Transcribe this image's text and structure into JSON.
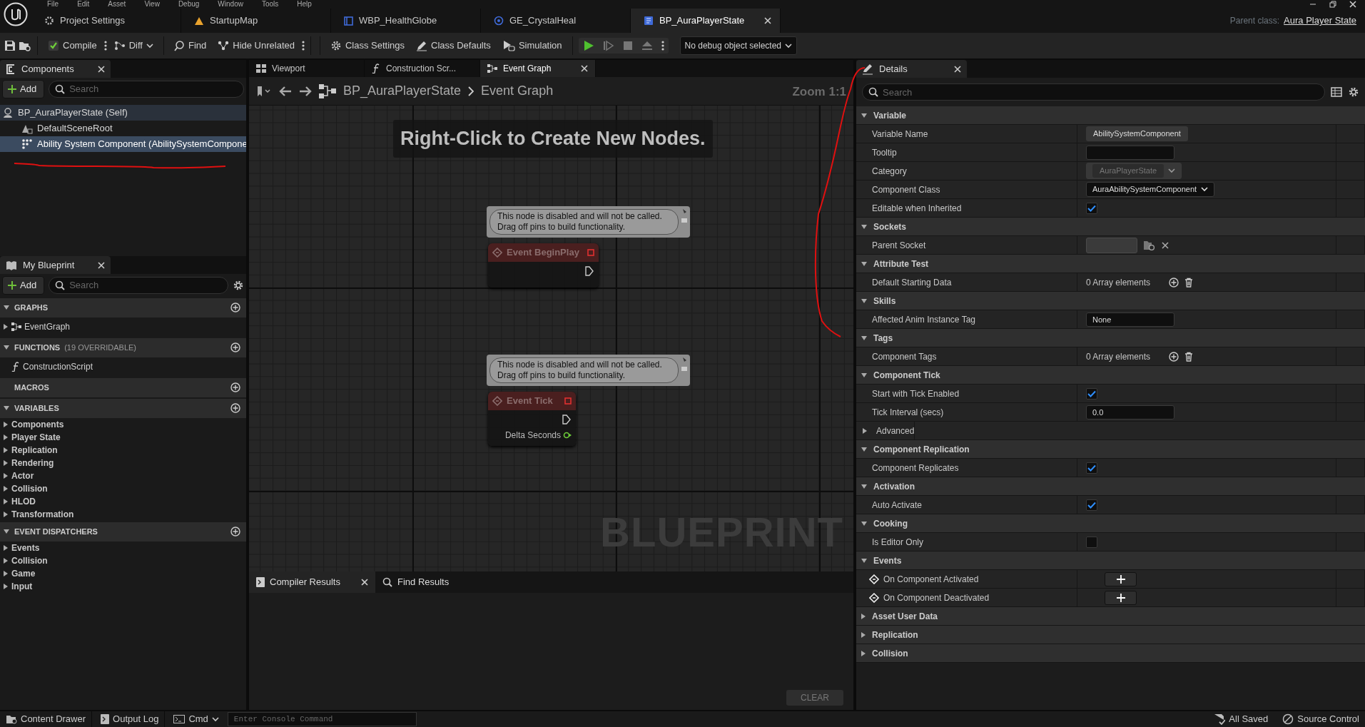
{
  "menu": [
    "File",
    "Edit",
    "Asset",
    "View",
    "Debug",
    "Window",
    "Tools",
    "Help"
  ],
  "document_tabs": [
    {
      "label": "Project Settings",
      "kind": "settings",
      "selected": false
    },
    {
      "label": "StartupMap",
      "kind": "map",
      "selected": false
    },
    {
      "label": "WBP_HealthGlobe",
      "kind": "widget",
      "selected": false
    },
    {
      "label": "GE_CrystalHeal",
      "kind": "effect",
      "selected": false
    },
    {
      "label": "BP_AuraPlayerState",
      "kind": "blueprint",
      "selected": true
    }
  ],
  "parent_class": {
    "label": "Parent class:",
    "value": "Aura Player State"
  },
  "toolbar": [
    {
      "label": "Compile",
      "kind": "compile"
    },
    {
      "label": "Diff",
      "kind": "diff"
    },
    {
      "label": "Find",
      "kind": "find"
    },
    {
      "label": "Hide Unrelated",
      "kind": "hide"
    },
    {
      "label": "Class Settings",
      "kind": "settings"
    },
    {
      "label": "Class Defaults",
      "kind": "defaults"
    },
    {
      "label": "Simulation",
      "kind": "simulation"
    }
  ],
  "debug_selector": "No debug object selected",
  "components_panel": {
    "title": "Components",
    "add": "Add",
    "search_placeholder": "Search",
    "tree": [
      {
        "label": "BP_AuraPlayerState (Self)",
        "selected": false,
        "children": [
          {
            "label": "DefaultSceneRoot",
            "kind": "scene",
            "selected": false
          },
          {
            "label": "Ability System Component (AbilitySystemCompone",
            "kind": "component",
            "selected": true
          }
        ]
      }
    ]
  },
  "my_blueprint": {
    "title": "My Blueprint",
    "add": "Add",
    "search_placeholder": "Search",
    "sections": [
      {
        "title": "GRAPHS",
        "items": [
          {
            "label": "EventGraph",
            "kind": "graph"
          }
        ]
      },
      {
        "title": "FUNCTIONS",
        "note": "(19 OVERRIDABLE)",
        "items": [
          {
            "label": "ConstructionScript",
            "kind": "function"
          }
        ]
      },
      {
        "title": "MACROS"
      },
      {
        "title": "VARIABLES",
        "items": [
          {
            "label": "Components",
            "kind": "category"
          },
          {
            "label": "Player State",
            "kind": "category"
          },
          {
            "label": "Replication",
            "kind": "category"
          },
          {
            "label": "Rendering",
            "kind": "category"
          },
          {
            "label": "Actor",
            "kind": "category"
          },
          {
            "label": "Collision",
            "kind": "category"
          },
          {
            "label": "HLOD",
            "kind": "category"
          },
          {
            "label": "Transformation",
            "kind": "category"
          }
        ]
      },
      {
        "title": "EVENT DISPATCHERS",
        "items": [
          {
            "label": "Events",
            "kind": "category"
          },
          {
            "label": "Collision",
            "kind": "category"
          },
          {
            "label": "Game",
            "kind": "category"
          },
          {
            "label": "Input",
            "kind": "category"
          }
        ]
      }
    ]
  },
  "editor_tabs": [
    {
      "label": "Viewport",
      "kind": "viewport",
      "selected": false
    },
    {
      "label": "Construction Scr...",
      "kind": "function",
      "selected": false
    },
    {
      "label": "Event Graph",
      "kind": "graph",
      "selected": true
    }
  ],
  "breadcrumb": [
    "BP_AuraPlayerState",
    "Event Graph"
  ],
  "zoom": "Zoom 1:1",
  "graph": {
    "hint": "Right-Click to Create New Nodes.",
    "watermark": "BLUEPRINT",
    "nodes": [
      {
        "title": "Event BeginPlay",
        "comment": "This node is disabled and will not be called.\nDrag off pins to build functionality.",
        "disabled": true
      },
      {
        "title": "Event Tick",
        "comment": "This node is disabled and will not be called.\nDrag off pins to build functionality.",
        "disabled": true,
        "pins": [
          {
            "label": "Delta Seconds"
          }
        ]
      }
    ]
  },
  "results_tabs": [
    {
      "label": "Compiler Results",
      "kind": "compiler",
      "selected": true
    },
    {
      "label": "Find Results",
      "kind": "find",
      "selected": false
    }
  ],
  "clear_button": {
    "label": "CLEAR",
    "disabled": true
  },
  "details": {
    "title": "Details",
    "search_placeholder": "Search",
    "sections": [
      {
        "title": "Variable",
        "expanded": true,
        "rows": [
          {
            "label": "Variable Name",
            "kind": "name",
            "value": "AbilitySystemComponent"
          },
          {
            "label": "Tooltip",
            "kind": "text"
          },
          {
            "label": "Category",
            "kind": "combo",
            "value": "AuraPlayerState",
            "disabled": true
          },
          {
            "label": "Component Class",
            "kind": "combo",
            "value": "AuraAbilitySystemComponent",
            "disabled": false
          },
          {
            "label": "Editable when Inherited",
            "kind": "checkbox",
            "checked": true
          }
        ]
      },
      {
        "title": "Sockets",
        "expanded": true,
        "rows": [
          {
            "label": "Parent Socket",
            "kind": "socket"
          }
        ]
      },
      {
        "title": "Attribute Test",
        "expanded": true,
        "rows": [
          {
            "label": "Default Starting Data",
            "kind": "array",
            "value": "0 Array elements"
          }
        ]
      },
      {
        "title": "Skills",
        "expanded": true,
        "rows": [
          {
            "label": "Affected Anim Instance Tag",
            "kind": "text",
            "value": "None"
          }
        ]
      },
      {
        "title": "Tags",
        "expanded": true,
        "rows": [
          {
            "label": "Component Tags",
            "kind": "array",
            "value": "0 Array elements"
          }
        ]
      },
      {
        "title": "Component Tick",
        "expanded": true,
        "rows": [
          {
            "label": "Start with Tick Enabled",
            "kind": "checkbox",
            "checked": true
          },
          {
            "label": "Tick Interval (secs)",
            "kind": "text",
            "value": "0.0"
          },
          {
            "label": "Advanced",
            "kind": "group",
            "expanded": false
          }
        ]
      },
      {
        "title": "Component Replication",
        "expanded": true,
        "rows": [
          {
            "label": "Component Replicates",
            "kind": "checkbox",
            "checked": true
          }
        ]
      },
      {
        "title": "Activation",
        "expanded": true,
        "rows": [
          {
            "label": "Auto Activate",
            "kind": "checkbox",
            "checked": true
          }
        ]
      },
      {
        "title": "Cooking",
        "expanded": true,
        "rows": [
          {
            "label": "Is Editor Only",
            "kind": "checkbox",
            "checked": false
          }
        ]
      },
      {
        "title": "Events",
        "expanded": true,
        "rows": [
          {
            "label": "On Component Activated",
            "kind": "event"
          },
          {
            "label": "On Component Deactivated",
            "kind": "event"
          }
        ]
      },
      {
        "title": "Asset User Data",
        "expanded": false
      },
      {
        "title": "Replication",
        "expanded": false
      },
      {
        "title": "Collision",
        "expanded": false
      }
    ]
  },
  "status_bar": {
    "left": [
      {
        "label": "Content Drawer",
        "kind": "drawer"
      },
      {
        "label": "Output Log",
        "kind": "log"
      }
    ],
    "cmd": "Cmd",
    "console_placeholder": "Enter Console Command",
    "right": [
      {
        "label": "All Saved",
        "kind": "saved"
      },
      {
        "label": "Source Control",
        "kind": "source"
      }
    ]
  }
}
